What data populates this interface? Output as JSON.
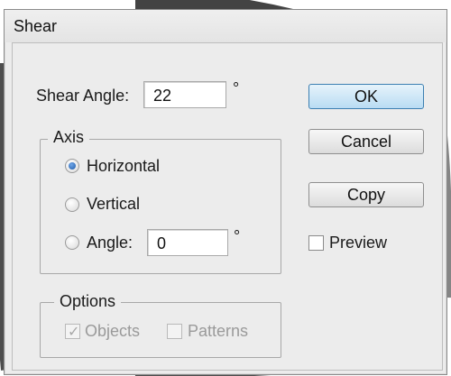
{
  "dialog": {
    "title": "Shear"
  },
  "shear_angle": {
    "label": "Shear Angle:",
    "value": "22",
    "unit": "°"
  },
  "axis": {
    "title": "Axis",
    "options": [
      {
        "label": "Horizontal",
        "checked": true
      },
      {
        "label": "Vertical",
        "checked": false
      },
      {
        "label": "Angle:",
        "checked": false
      }
    ],
    "angle_value": "0",
    "angle_unit": "°"
  },
  "options_group": {
    "title": "Options",
    "objects": {
      "label": "Objects",
      "checked": true,
      "enabled": false
    },
    "patterns": {
      "label": "Patterns",
      "checked": false,
      "enabled": false
    }
  },
  "buttons": {
    "ok": "OK",
    "cancel": "Cancel",
    "copy": "Copy"
  },
  "preview": {
    "label": "Preview",
    "checked": false
  },
  "colors": {
    "accent": "#1e5aa8",
    "default_button": "#b9dcf3"
  }
}
